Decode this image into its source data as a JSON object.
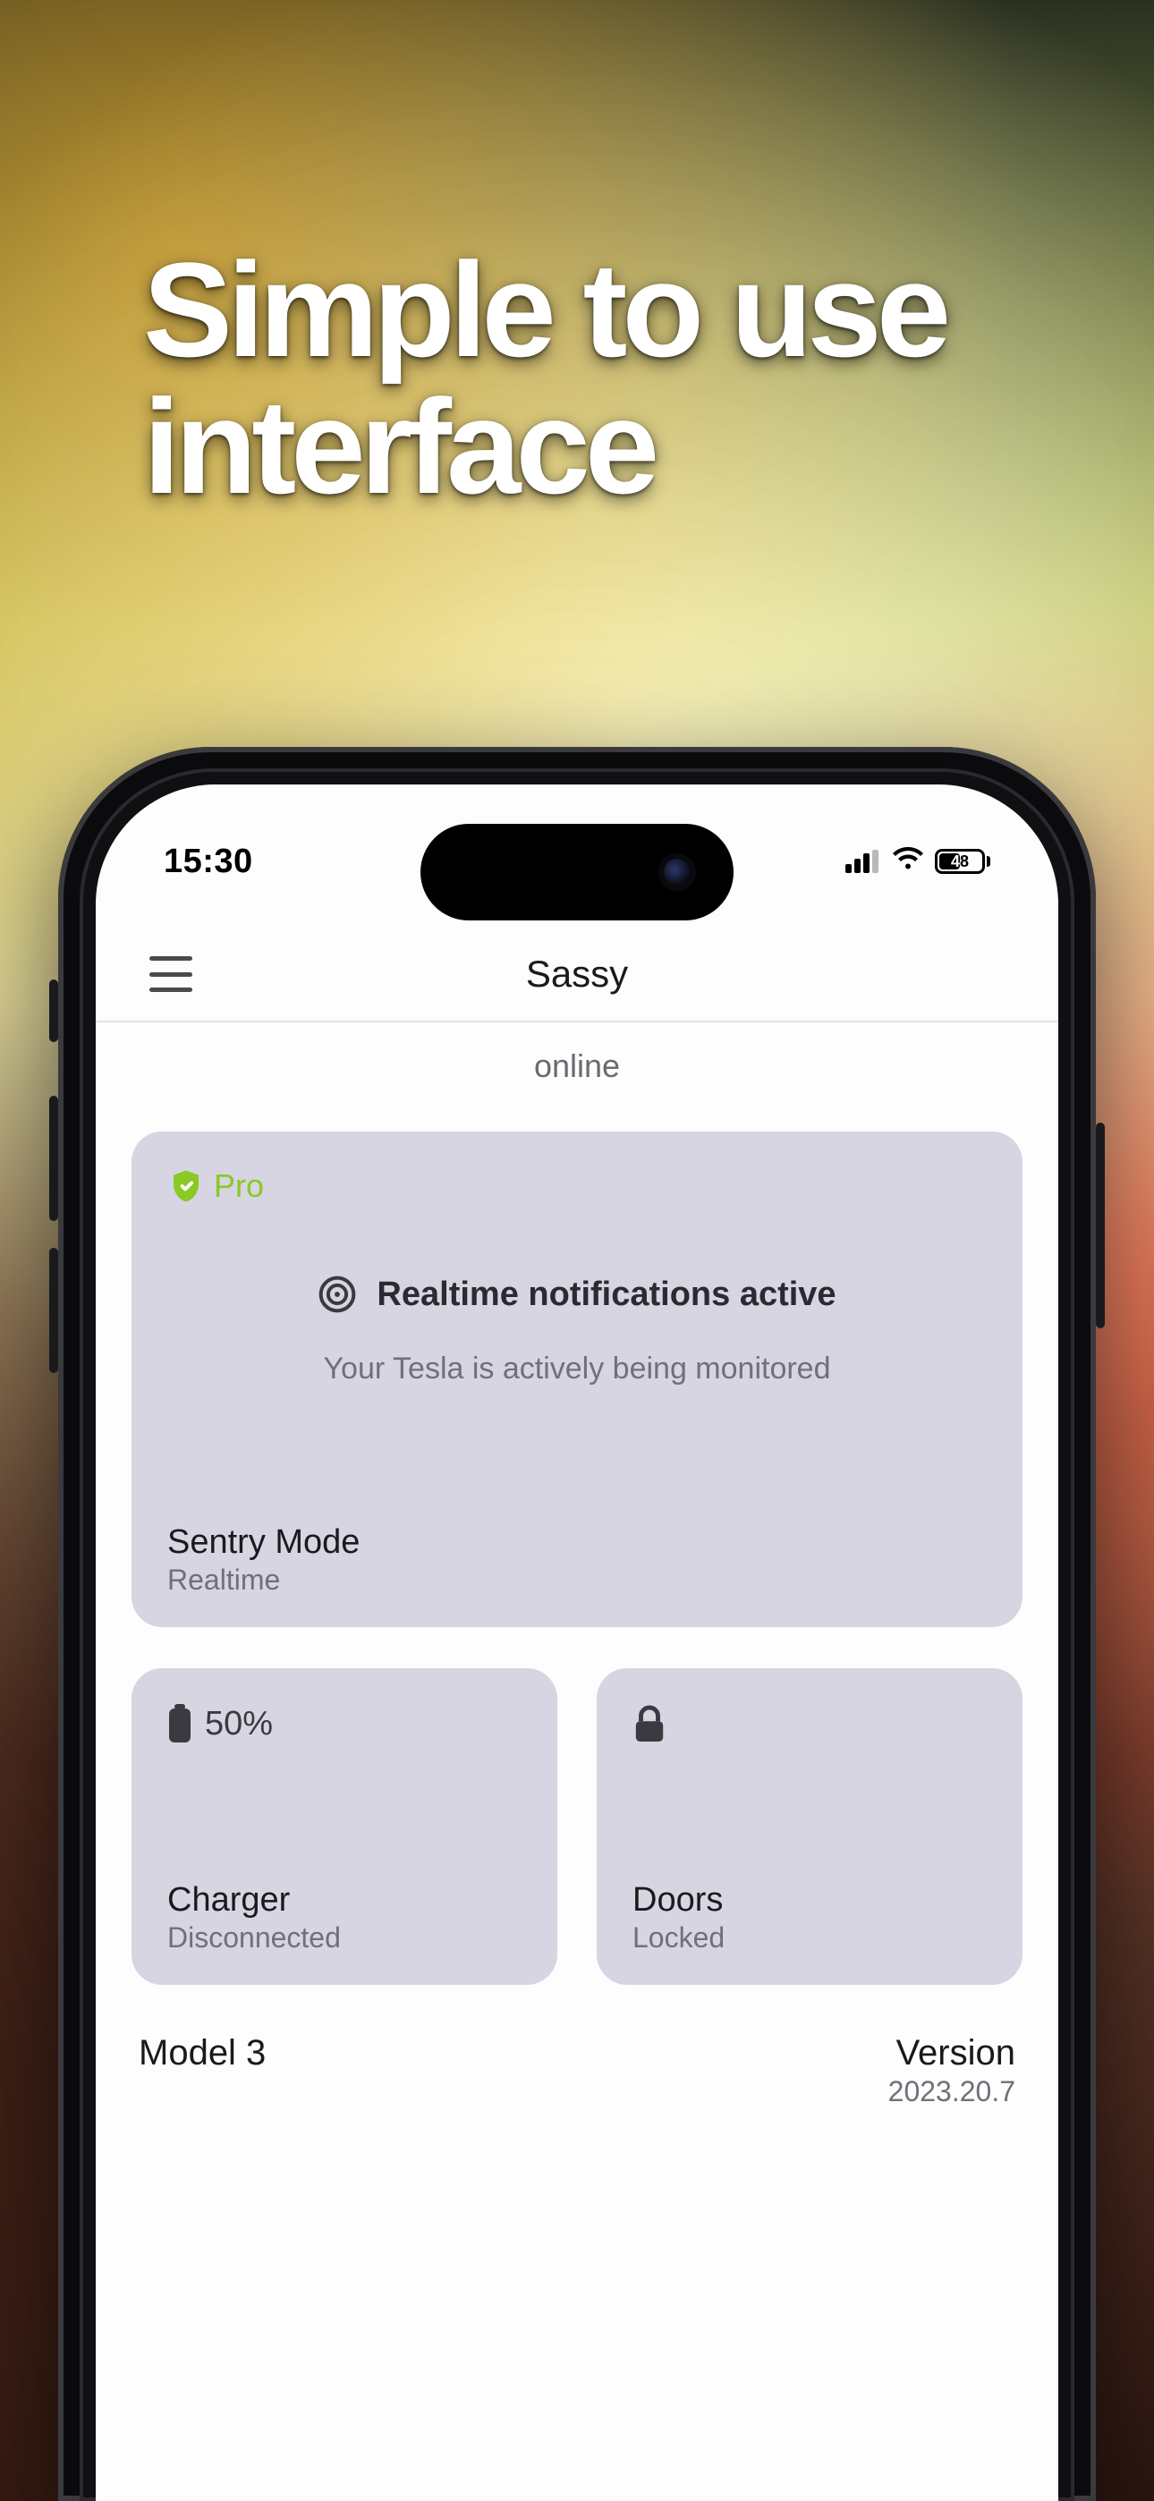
{
  "marketing_headline": "Simple to use\ninterface",
  "statusbar": {
    "time": "15:30",
    "battery_pct": "48"
  },
  "nav": {
    "title": "Sassy"
  },
  "status_text": "online",
  "sentry_card": {
    "pro_label": "Pro",
    "headline": "Realtime notifications active",
    "subline": "Your Tesla is actively being monitored",
    "footer_title": "Sentry Mode",
    "footer_sub": "Realtime"
  },
  "charger_card": {
    "battery_pct": "50%",
    "title": "Charger",
    "sub": "Disconnected"
  },
  "doors_card": {
    "title": "Doors",
    "sub": "Locked"
  },
  "vehicle": {
    "model": "Model 3",
    "version_label": "Version",
    "version": "2023.20.7"
  }
}
